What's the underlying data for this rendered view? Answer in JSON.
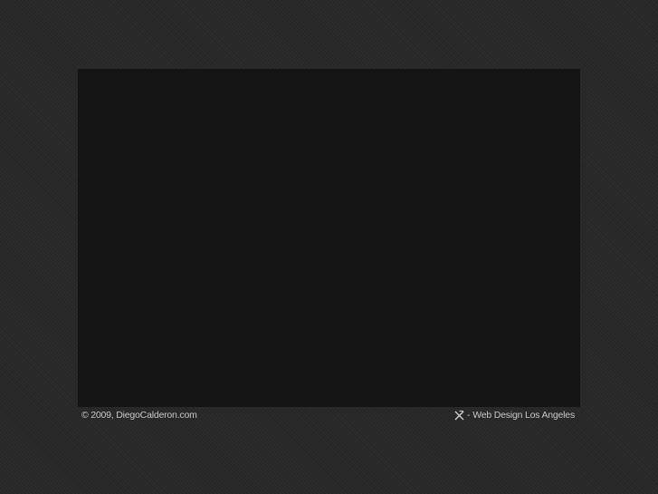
{
  "content": {
    "stage_label": ""
  },
  "footer": {
    "copyright": "© 2009, DiegoCalderon.com",
    "logo_icon": "x-logo-icon",
    "credit_prefix": "- ",
    "credit_link": "Web Design Los Angeles"
  },
  "colors": {
    "page_background": "#262626",
    "stage_background": "#141414",
    "footer_text": "#c8c8c8"
  }
}
